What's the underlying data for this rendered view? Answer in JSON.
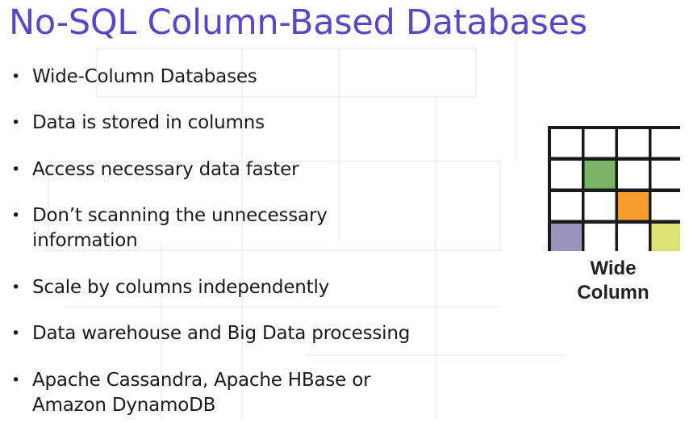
{
  "slide": {
    "title": "No-SQL Column-Based Databases",
    "bullet_symbol": "•",
    "bullets": [
      "Wide-Column Databases",
      "Data is stored in columns",
      "Access necessary data faster",
      "Don’t scanning the unnecessary information",
      "Scale by columns independently",
      "Data warehouse and Big Data processing",
      "Apache Cassandra, Apache HBase or Amazon DynamoDB"
    ]
  },
  "diagram": {
    "label_line1": "Wide",
    "label_line2": "Column",
    "highlight_colors": {
      "green": "#77b466",
      "orange": "#f59c30",
      "purple": "#9a93bd",
      "yellow": "#dce274"
    }
  },
  "colors": {
    "title": "#5a46c8",
    "text": "#1a1a1a"
  }
}
